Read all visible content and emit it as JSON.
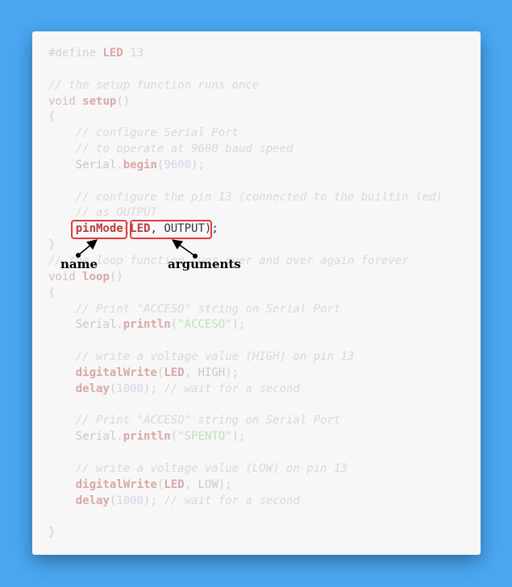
{
  "code": {
    "lines": [
      [
        {
          "t": "#define ",
          "c": "pp"
        },
        {
          "t": "LED",
          "c": "fn"
        },
        {
          "t": " 13",
          "c": "num"
        }
      ],
      [],
      [
        {
          "t": "// the setup function runs once",
          "c": "cm"
        }
      ],
      [
        {
          "t": "void",
          "c": "kw"
        },
        {
          "t": " ",
          "c": "pn"
        },
        {
          "t": "setup",
          "c": "fn"
        },
        {
          "t": "()",
          "c": "pn"
        }
      ],
      [
        {
          "t": "{",
          "c": "pn"
        }
      ],
      [
        {
          "t": "    // configure Serial Port",
          "c": "cm"
        }
      ],
      [
        {
          "t": "    // to operate at 9600 baud speed",
          "c": "cm"
        }
      ],
      [
        {
          "t": "    ",
          "c": "pn"
        },
        {
          "t": "Serial",
          "c": "id"
        },
        {
          "t": ".",
          "c": "pn"
        },
        {
          "t": "begin",
          "c": "fn"
        },
        {
          "t": "(",
          "c": "pn"
        },
        {
          "t": "9600",
          "c": "num"
        },
        {
          "t": ");",
          "c": "pn"
        }
      ],
      [],
      [
        {
          "t": "    // configure the pin 13 (connected to the builtin led)",
          "c": "cm"
        }
      ],
      [
        {
          "t": "    // as OUTPUT",
          "c": "cm"
        }
      ],
      [
        {
          "t": "    ",
          "c": "pn"
        },
        {
          "t": "pinMode",
          "c": "hl-fn"
        },
        {
          "t": "(",
          "c": "hl-pn"
        },
        {
          "t": "LED",
          "c": "hl-fn"
        },
        {
          "t": ", ",
          "c": "hl-pn"
        },
        {
          "t": "OUTPUT",
          "c": "hl-id"
        },
        {
          "t": ")",
          "c": "hl-pn"
        },
        {
          "t": ";",
          "c": "hl-pn"
        }
      ],
      [
        {
          "t": "}",
          "c": "pn"
        }
      ],
      [
        {
          "t": "// the loop function runs over and over again forever",
          "c": "cm"
        }
      ],
      [
        {
          "t": "void",
          "c": "kw"
        },
        {
          "t": " ",
          "c": "pn"
        },
        {
          "t": "loop",
          "c": "fn"
        },
        {
          "t": "()",
          "c": "pn"
        }
      ],
      [
        {
          "t": "{",
          "c": "pn"
        }
      ],
      [
        {
          "t": "    // Print \"ACCESO\" string on Serial Port",
          "c": "cm"
        }
      ],
      [
        {
          "t": "    ",
          "c": "pn"
        },
        {
          "t": "Serial",
          "c": "id"
        },
        {
          "t": ".",
          "c": "pn"
        },
        {
          "t": "println",
          "c": "fn"
        },
        {
          "t": "(",
          "c": "pn"
        },
        {
          "t": "\"ACCESO\"",
          "c": "str"
        },
        {
          "t": ");",
          "c": "pn"
        }
      ],
      [],
      [
        {
          "t": "    // write a voltage value (HIGH) on pin 13",
          "c": "cm"
        }
      ],
      [
        {
          "t": "    ",
          "c": "pn"
        },
        {
          "t": "digitalWrite",
          "c": "fn"
        },
        {
          "t": "(",
          "c": "pn"
        },
        {
          "t": "LED",
          "c": "fn"
        },
        {
          "t": ", ",
          "c": "pn"
        },
        {
          "t": "HIGH",
          "c": "id"
        },
        {
          "t": ");",
          "c": "pn"
        }
      ],
      [
        {
          "t": "    ",
          "c": "pn"
        },
        {
          "t": "delay",
          "c": "fn"
        },
        {
          "t": "(",
          "c": "pn"
        },
        {
          "t": "1000",
          "c": "num"
        },
        {
          "t": "); ",
          "c": "pn"
        },
        {
          "t": "// wait for a second",
          "c": "cm"
        }
      ],
      [],
      [
        {
          "t": "    // Print \"ACCESO\" string on Serial Port",
          "c": "cm"
        }
      ],
      [
        {
          "t": "    ",
          "c": "pn"
        },
        {
          "t": "Serial",
          "c": "id"
        },
        {
          "t": ".",
          "c": "pn"
        },
        {
          "t": "println",
          "c": "fn"
        },
        {
          "t": "(",
          "c": "pn"
        },
        {
          "t": "\"SPENTO\"",
          "c": "str"
        },
        {
          "t": ");",
          "c": "pn"
        }
      ],
      [],
      [
        {
          "t": "    // write a voltage value (LOW) on pin 13",
          "c": "cm"
        }
      ],
      [
        {
          "t": "    ",
          "c": "pn"
        },
        {
          "t": "digitalWrite",
          "c": "fn"
        },
        {
          "t": "(",
          "c": "pn"
        },
        {
          "t": "LED",
          "c": "fn"
        },
        {
          "t": ", ",
          "c": "pn"
        },
        {
          "t": "LOW",
          "c": "id"
        },
        {
          "t": ");",
          "c": "pn"
        }
      ],
      [
        {
          "t": "    ",
          "c": "pn"
        },
        {
          "t": "delay",
          "c": "fn"
        },
        {
          "t": "(",
          "c": "pn"
        },
        {
          "t": "1000",
          "c": "num"
        },
        {
          "t": "); ",
          "c": "pn"
        },
        {
          "t": "// wait for a second",
          "c": "cm"
        }
      ],
      [],
      [
        {
          "t": "}",
          "c": "pn"
        }
      ]
    ]
  },
  "annotations": {
    "name_label": "name",
    "arguments_label": "arguments",
    "highlight_color": "#e23a3a"
  },
  "colors": {
    "background": "#4aa7f2",
    "card": "#f7f7f7"
  }
}
